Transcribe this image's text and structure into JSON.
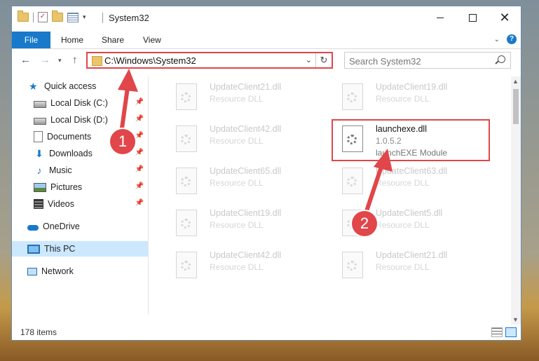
{
  "window": {
    "title": "System32",
    "controls": {
      "minimize": "–",
      "maximize": "☐",
      "close": "✕"
    }
  },
  "ribbon": {
    "tabs": [
      "File",
      "Home",
      "Share",
      "View"
    ]
  },
  "nav": {
    "address": "C:\\Windows\\System32",
    "search_placeholder": "Search System32"
  },
  "sidebar": {
    "items": [
      {
        "label": "Quick access",
        "icon": "star-icon"
      },
      {
        "label": "Local Disk (C:)",
        "icon": "disk-icon",
        "pinned": true
      },
      {
        "label": "Local Disk (D:)",
        "icon": "disk-icon",
        "pinned": true
      },
      {
        "label": "Documents",
        "icon": "documents-icon",
        "pinned": true
      },
      {
        "label": "Downloads",
        "icon": "download-icon",
        "pinned": true
      },
      {
        "label": "Music",
        "icon": "music-icon",
        "pinned": true
      },
      {
        "label": "Pictures",
        "icon": "pictures-icon",
        "pinned": true
      },
      {
        "label": "Videos",
        "icon": "videos-icon",
        "pinned": true
      },
      {
        "label": "OneDrive",
        "icon": "cloud-icon"
      },
      {
        "label": "This PC",
        "icon": "pc-icon",
        "selected": true
      },
      {
        "label": "Network",
        "icon": "network-icon"
      }
    ]
  },
  "files": [
    {
      "name": "UpdateClient21.dll",
      "desc": "Resource DLL"
    },
    {
      "name": "UpdateClient19.dll",
      "desc": "Resource DLL"
    },
    {
      "name": "UpdateClient42.dll",
      "desc": "Resource DLL"
    },
    {
      "name": "launchexe.dll",
      "version": "1.0.5.2",
      "desc": "launchEXE Module",
      "featured": true
    },
    {
      "name": "UpdateClient65.dll",
      "desc": "Resource DLL"
    },
    {
      "name": "UpdateClient63.dll",
      "desc": "Resource DLL"
    },
    {
      "name": "UpdateClient19.dll",
      "desc": "Resource DLL"
    },
    {
      "name": "UpdateClient5.dll",
      "desc": "Resource DLL"
    },
    {
      "name": "UpdateClient42.dll",
      "desc": "Resource DLL"
    },
    {
      "name": "UpdateClient21.dll",
      "desc": "Resource DLL"
    }
  ],
  "status": {
    "item_count": "178 items"
  },
  "annotations": {
    "step1": "1",
    "step2": "2",
    "accent_color": "#e0464a"
  }
}
